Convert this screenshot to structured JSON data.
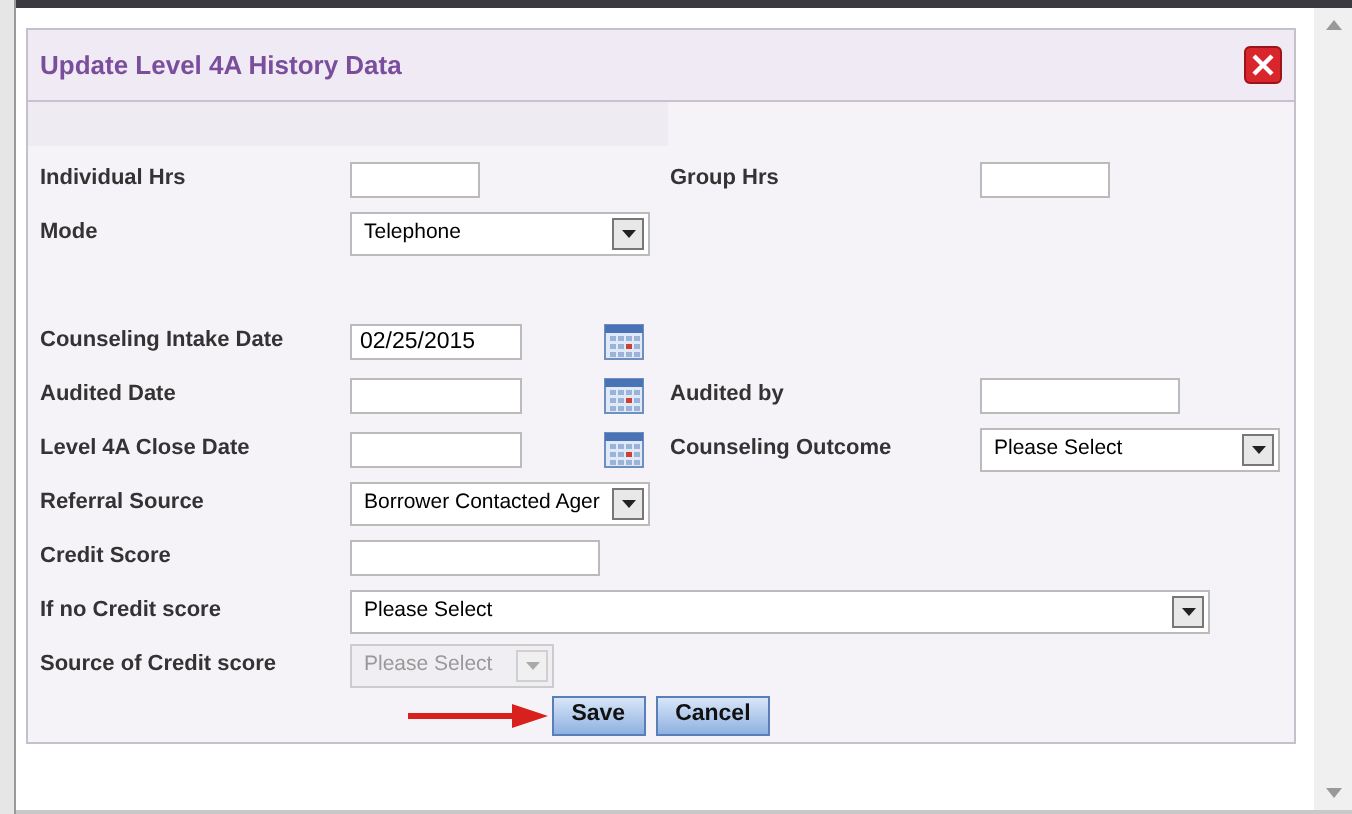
{
  "dialog": {
    "title": "Update Level 4A History Data"
  },
  "sections": [
    {
      "rows": [
        {
          "fields": [
            {
              "label": "Individual Hrs",
              "kind": "hours"
            },
            {
              "label": "Group Hrs",
              "kind": "hours"
            }
          ]
        },
        {
          "fields": [
            {
              "label": "Mode",
              "kind": "select",
              "value": "Telephone",
              "disabled": false
            }
          ]
        }
      ]
    },
    {
      "rows": [
        {
          "fields": [
            {
              "label": "Counseling Intake Date",
              "kind": "date",
              "value": "02/25/2015"
            }
          ]
        },
        {
          "fields": [
            {
              "label": "Audited Date",
              "kind": "date"
            },
            {
              "label": "Audited by",
              "kind": "text"
            }
          ]
        },
        {
          "fields": [
            {
              "label": "Level 4A Close Date",
              "kind": "date"
            },
            {
              "label": "Counseling Outcome",
              "kind": "select",
              "value": "Please Select",
              "disabled": false
            }
          ]
        },
        {
          "fields": [
            {
              "label": "Referral Source",
              "kind": "select",
              "value": "Borrower Contacted Ager",
              "disabled": false
            }
          ]
        },
        {
          "fields": [
            {
              "label": "Credit Score",
              "kind": "text"
            }
          ]
        },
        {
          "fields": [
            {
              "label": "If no Credit score",
              "kind": "wide-select",
              "value": "Please Select",
              "disabled": false
            }
          ]
        },
        {
          "fields": [
            {
              "label": "Source of Credit score",
              "kind": "compact-select",
              "value": "Please Select",
              "disabled": true
            }
          ]
        }
      ]
    }
  ],
  "buttons": [
    {
      "label": "Save"
    },
    {
      "label": "Cancel"
    }
  ]
}
